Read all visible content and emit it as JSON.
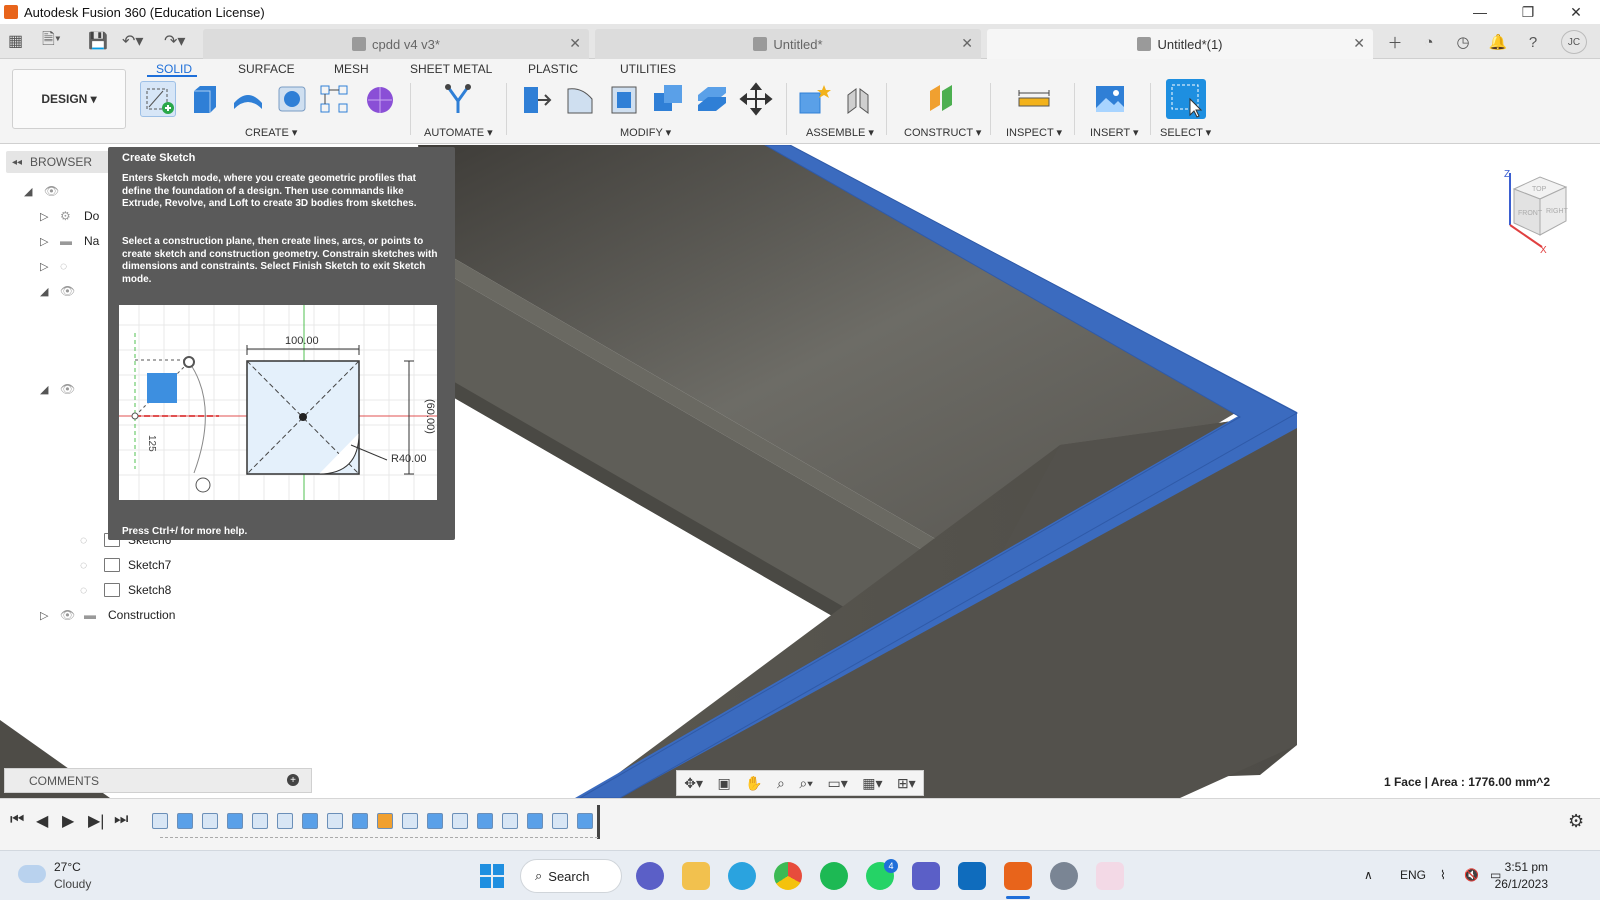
{
  "window": {
    "title": "Autodesk Fusion 360 (Education License)"
  },
  "doc_tabs": [
    {
      "label": "cpdd v4 v3*",
      "active": false
    },
    {
      "label": "Untitled*",
      "active": false
    },
    {
      "label": "Untitled*(1)",
      "active": true
    }
  ],
  "profile_initials": "JC",
  "ribbon": {
    "workspace": "DESIGN",
    "tabs": [
      "SOLID",
      "SURFACE",
      "MESH",
      "SHEET METAL",
      "PLASTIC",
      "UTILITIES"
    ],
    "groups": [
      "CREATE",
      "AUTOMATE",
      "MODIFY",
      "ASSEMBLE",
      "CONSTRUCT",
      "INSPECT",
      "INSERT",
      "SELECT"
    ]
  },
  "browser": {
    "header": "BROWSER",
    "rows": [
      {
        "label": "Do"
      },
      {
        "label": "Na"
      },
      {
        "label": "Sketch6"
      },
      {
        "label": "Sketch7"
      },
      {
        "label": "Sketch8"
      },
      {
        "label": "Construction"
      }
    ]
  },
  "tooltip": {
    "title": "Create Sketch",
    "p1": "Enters Sketch mode, where you create geometric profiles that define the foundation of a design. Then use commands like Extrude, Revolve, and Loft to create 3D bodies from sketches.",
    "p2": "Select a construction plane, then create lines, arcs, or points to create sketch and construction geometry. Constrain sketches with dimensions and constraints. Select Finish Sketch to exit Sketch mode.",
    "footer": "Press Ctrl+/ for more help.",
    "dims": {
      "width": "100.00",
      "height": "(60.00)",
      "radius": "R40.00",
      "arc": "125"
    }
  },
  "comments": {
    "label": "COMMENTS"
  },
  "status": {
    "selection": "1 Face | Area : 1776.00 mm^2"
  },
  "viewcube": {
    "top": "TOP",
    "front": "FRONT",
    "right": "RIGHT",
    "z": "Z",
    "x": "X"
  },
  "taskbar": {
    "weather_temp": "27°C",
    "weather_desc": "Cloudy",
    "search": "Search",
    "lang": "ENG",
    "time": "3:51 pm",
    "date": "26/1/2023",
    "chat_badge": "4"
  },
  "colors": {
    "accent": "#1e6fd9",
    "face_blue": "#3b6bbf",
    "body_gray": "#57554f"
  }
}
